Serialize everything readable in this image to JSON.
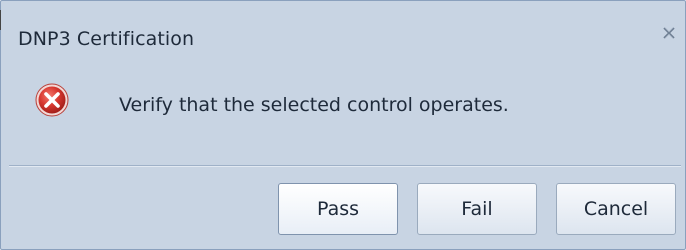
{
  "dialog": {
    "title": "DNP3 Certification",
    "message": "Verify that the selected control operates.",
    "icon": "error-icon",
    "close_icon": "close-icon"
  },
  "buttons": {
    "pass_label": "Pass",
    "fail_label": "Fail",
    "cancel_label": "Cancel"
  },
  "colors": {
    "dialog_background": "#c8d4e3",
    "border": "#8aa0bd",
    "error_red": "#d7372f",
    "text": "#1e2a3a"
  }
}
